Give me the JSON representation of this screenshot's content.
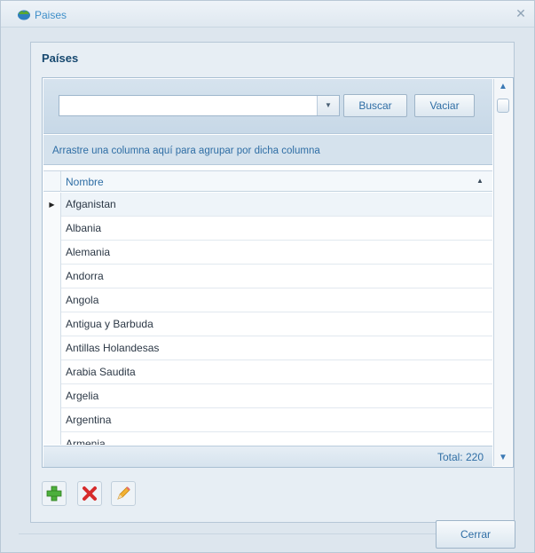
{
  "window": {
    "title": "Paises",
    "close_icon": "close-x-icon"
  },
  "group": {
    "title": "Países"
  },
  "search": {
    "value": "",
    "buscar_label": "Buscar",
    "vaciar_label": "Vaciar"
  },
  "grid": {
    "group_panel_text": "Arrastre una columna aquí para agrupar por dicha columna",
    "column_header": "Nombre",
    "rows": [
      "Afganistan",
      "Albania",
      "Alemania",
      "Andorra",
      "Angola",
      "Antigua y Barbuda",
      "Antillas Holandesas",
      "Arabia Saudita",
      "Argelia",
      "Argentina",
      "Armenia"
    ],
    "current_row_index": 0,
    "total_text": "Total: 220"
  },
  "toolbar": {
    "add_icon": "add-plus-icon",
    "delete_icon": "delete-x-icon",
    "edit_icon": "edit-pencil-icon"
  },
  "footer": {
    "close_label": "Cerrar"
  },
  "colors": {
    "accent": "#2f6ea5",
    "title": "#16486f"
  }
}
